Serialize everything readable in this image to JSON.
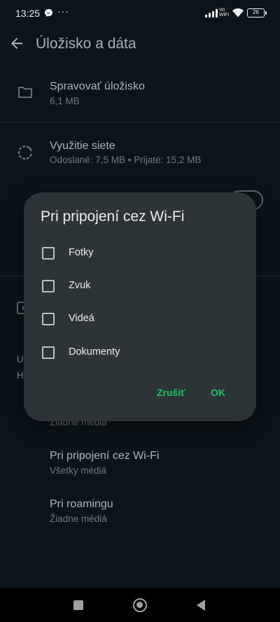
{
  "status_bar": {
    "time": "13:25",
    "dots": "···",
    "vo": "Vo",
    "wifi_label": "WiFi",
    "battery": "26",
    "icons": [
      "messenger-icon",
      "signal-icon",
      "wifi-icon",
      "battery-icon"
    ]
  },
  "app_bar": {
    "title": "Úložisko a dáta",
    "back_icon": "arrow-left-icon"
  },
  "storage": {
    "manage_title": "Spravovať úložisko",
    "manage_sub": "6,1 MB",
    "network_title": "Využitie siete",
    "network_sub": "Odoslané: 7,5 MB • Prijaté: 15,2 MB",
    "hidden_partial_left_1": "U",
    "hidden_partial_left_2": "H"
  },
  "media_download": {
    "mobile_sub": "Žiadne médiá",
    "wifi_title": "Pri pripojení cez Wi-Fi",
    "wifi_sub": "Všetky médiá",
    "roaming_title": "Pri roamingu",
    "roaming_sub": "Žiadne médiá"
  },
  "dialog": {
    "title": "Pri pripojení cez Wi-Fi",
    "options": [
      {
        "label": "Fotky",
        "checked": false
      },
      {
        "label": "Zvuk",
        "checked": false
      },
      {
        "label": "Videá",
        "checked": false
      },
      {
        "label": "Dokumenty",
        "checked": false
      }
    ],
    "cancel_label": "Zrušiť",
    "ok_label": "OK"
  },
  "colors": {
    "background": "#0b141a",
    "dialog": "#2c3438",
    "accent": "#21c063",
    "text_primary": "#e9edef",
    "text_secondary": "#6f7a80"
  }
}
